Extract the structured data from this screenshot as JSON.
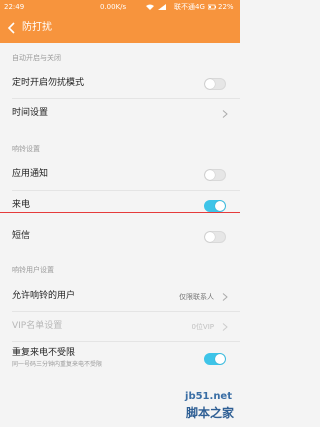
{
  "statusbar": {
    "time": "22:49",
    "network_speed": "0.00K/s",
    "carrier": "联不通4G",
    "battery": "22%"
  },
  "header": {
    "back_icon": "chevron-left-icon",
    "title": "防打扰",
    "color": "#f7943d"
  },
  "sections": {
    "auto": "自动开启与关闭",
    "ringtone": "响铃设置",
    "ring_users": "响铃用户设置"
  },
  "items": {
    "scheduled": {
      "label": "定时开启勿扰模式",
      "on": false
    },
    "time_settings": {
      "label": "时间设置"
    },
    "app_notify": {
      "label": "应用通知",
      "on": false
    },
    "incoming_call": {
      "label": "来电",
      "on": true
    },
    "sms": {
      "label": "短信",
      "on": false
    },
    "allowed_users": {
      "label": "允许响铃的用户",
      "value": "仅限联系人"
    },
    "vip_list": {
      "label": "VIP名单设置",
      "value": "0位VIP"
    },
    "repeat_call": {
      "label": "重复来电不受限",
      "sublabel": "同一号码三分钟内重复来电不受限",
      "on": true
    }
  },
  "watermark": {
    "site": "jb51.net",
    "name": "脚本之家"
  },
  "colors": {
    "toggle_on": "#3ec4e8",
    "highlight_line": "#e53b3b"
  }
}
